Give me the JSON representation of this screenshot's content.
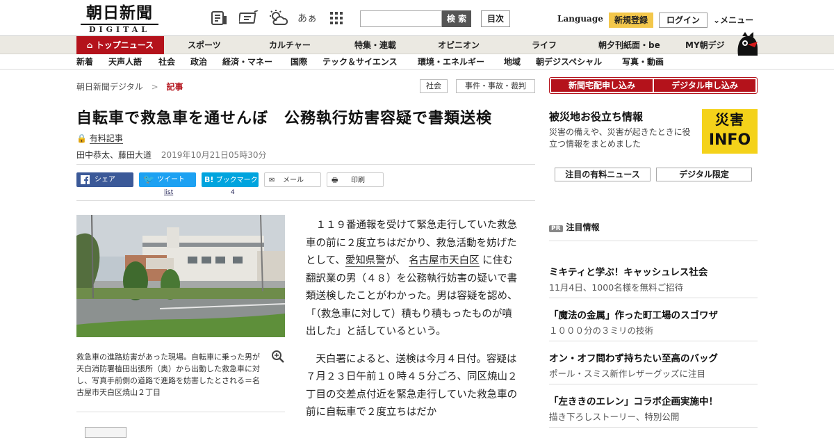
{
  "header": {
    "logo_jp": "朝日新聞",
    "logo_en": "DIGITAL",
    "icons": [
      "newspaper-icon",
      "megaphone-icon",
      "weather-icon",
      "font-size-icon",
      "grid-icon"
    ],
    "font_glyph": "あぁ",
    "search_placeholder": "",
    "search_label": "検 索",
    "index_label": "目次",
    "language": "Language",
    "register": "新規登録",
    "login": "ログイン",
    "menu": "メニュー"
  },
  "nav1": {
    "home": "トップニュース",
    "items": [
      "スポーツ",
      "カルチャー",
      "特集・連載",
      "オピニオン",
      "ライフ",
      "朝夕刊紙面・be",
      "MY朝デジ"
    ]
  },
  "nav2": [
    "新着",
    "天声人語",
    "社会",
    "政治",
    "経済・マネー",
    "国際",
    "テック＆サイエンス",
    "環境・エネルギー",
    "地域",
    "朝デジスペシャル",
    "写真・動画"
  ],
  "breadcrumb": {
    "home": "朝日新聞デジタル",
    "sep": ">",
    "current": "記事"
  },
  "tags": [
    "社会",
    "事件・事故・裁判"
  ],
  "article": {
    "title": "自転車で救急車を通せんぼ　公務執行妨害容疑で書類送検",
    "paid": "有料記事",
    "authors": "田中恭太、藤田大道",
    "date": "2019年10月21日05時30分",
    "share": {
      "share": "シェア",
      "tweet": "ツイート",
      "tweet_count": "list",
      "bookmark": "ブックマーク",
      "bookmark_count": "4",
      "mail": "メール",
      "print": "印刷"
    },
    "caption": "救急車の進路妨害があった現場。自転車に乗った男が天白消防署植田出張所（奥）から出動した救急車に対し、写真手前側の道路で進路を妨害したとされる＝名古屋市天白区焼山２丁目",
    "p1_a": "１１９番通報を受けて緊急走行していた救急車の前に２度立ちはだかり、救急活動を妨げたとして、",
    "p1_link1": "愛知県警",
    "p1_b": "が、",
    "p1_link2": "名古屋市天白区",
    "p1_c": "に住む翻訳業の男（４８）を公務執行妨害の疑いで書類送検したことがわかった。男は容疑を認め、「（救急車に対して）積もり積もったものが噴出した」と話しているという。",
    "p2": "天白署によると、送検は今月４日付。容疑は７月２３日午前１０時４５分ごろ、同区焼山２丁目の交差点付近を緊急走行していた救急車の前に自転車で２度立ちはだか"
  },
  "sidebar": {
    "btn_delivery": "新聞宅配申し込み",
    "btn_digital": "デジタル申し込み",
    "disaster_title": "被災地お役立ち情報",
    "disaster_desc": "災害の備えや、災害が起きたときに役立つ情報をまとめました",
    "disaster_badge_1": "災害",
    "disaster_badge_2": "INFO",
    "paid_news": "注目の有料ニュース",
    "digital_only": "デジタル限定",
    "pr_badge": "PR",
    "pr_label": "注目情報",
    "pr_items": [
      {
        "title": "ミキティと学ぶ！キャッシュレス社会",
        "desc": "11月4日、1000名様を無料ご招待"
      },
      {
        "title": "「魔法の金属」作った町工場のスゴワザ",
        "desc": "１０００分の３ミリの技術"
      },
      {
        "title": "オン・オフ問わず持ちたい至高のバッグ",
        "desc": "ポール・スミス新作レザーグッズに注目"
      },
      {
        "title": "「左ききのエレン」コラボ企画実施中！",
        "desc": "描き下ろしストーリー、特別公開"
      }
    ]
  },
  "colors": {
    "brand_red": "#b4121b",
    "register_yellow": "#f3c74b",
    "disaster_yellow": "#f4d21a",
    "facebook": "#3b5998",
    "twitter": "#1da1f2",
    "hatena": "#00a4de"
  }
}
